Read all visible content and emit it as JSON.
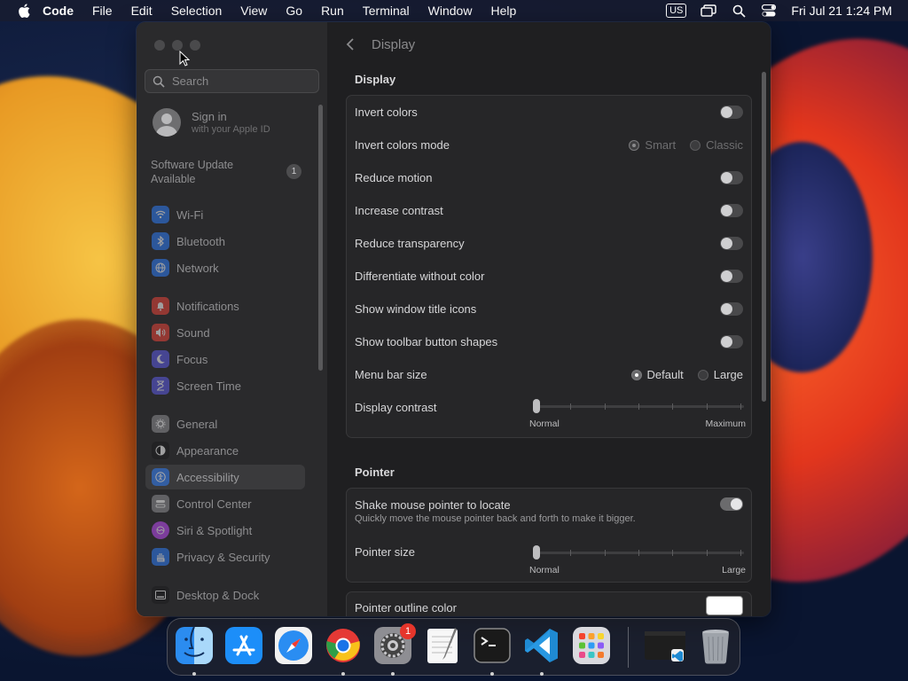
{
  "menubar": {
    "app_name": "Code",
    "items": [
      "File",
      "Edit",
      "Selection",
      "View",
      "Go",
      "Run",
      "Terminal",
      "Window",
      "Help"
    ],
    "input_source": "US",
    "clock": "Fri Jul 21  1:24 PM"
  },
  "sidebar": {
    "search_placeholder": "Search",
    "signin_title": "Sign in",
    "signin_subtitle": "with your Apple ID",
    "software_update": "Software Update Available",
    "update_count": "1",
    "items": [
      {
        "label": "Wi-Fi",
        "color": "#2f7cf6"
      },
      {
        "label": "Bluetooth",
        "color": "#2f7cf6"
      },
      {
        "label": "Network",
        "color": "#2f7cf6"
      },
      {
        "label": "Notifications",
        "color": "#e9443a"
      },
      {
        "label": "Sound",
        "color": "#e9443a"
      },
      {
        "label": "Focus",
        "color": "#5e5ce6"
      },
      {
        "label": "Screen Time",
        "color": "#5e5ce6"
      },
      {
        "label": "General",
        "color": "#8e8e93"
      },
      {
        "label": "Appearance",
        "color": "#1c1c1e"
      },
      {
        "label": "Accessibility",
        "color": "#2f7cf6"
      },
      {
        "label": "Control Center",
        "color": "#8e8e93"
      },
      {
        "label": "Siri & Spotlight",
        "color": "#c04df9"
      },
      {
        "label": "Privacy & Security",
        "color": "#2f7cf6"
      },
      {
        "label": "Desktop & Dock",
        "color": "#1c1c1e"
      }
    ],
    "selected": "Accessibility"
  },
  "main": {
    "title": "Display",
    "display_section": "Display",
    "display_rows": [
      {
        "label": "Invert colors",
        "control": "toggle",
        "on": false
      },
      {
        "label": "Invert colors mode",
        "control": "radio",
        "options": [
          "Smart",
          "Classic"
        ],
        "selected": "Smart",
        "disabled": true
      },
      {
        "label": "Reduce motion",
        "control": "toggle",
        "on": false
      },
      {
        "label": "Increase contrast",
        "control": "toggle",
        "on": false
      },
      {
        "label": "Reduce transparency",
        "control": "toggle",
        "on": false
      },
      {
        "label": "Differentiate without color",
        "control": "toggle",
        "on": false
      },
      {
        "label": "Show window title icons",
        "control": "toggle",
        "on": false
      },
      {
        "label": "Show toolbar button shapes",
        "control": "toggle",
        "on": false
      },
      {
        "label": "Menu bar size",
        "control": "radio",
        "options": [
          "Default",
          "Large"
        ],
        "selected": "Default",
        "disabled": false
      }
    ],
    "display_contrast": {
      "label": "Display contrast",
      "min_label": "Normal",
      "max_label": "Maximum",
      "value": 0
    },
    "pointer_section": "Pointer",
    "shake": {
      "label": "Shake mouse pointer to locate",
      "description": "Quickly move the mouse pointer back and forth to make it bigger.",
      "on": true
    },
    "pointer_size": {
      "label": "Pointer size",
      "min_label": "Normal",
      "max_label": "Large",
      "value": 0
    },
    "outline_color": {
      "label": "Pointer outline color",
      "color": "#ffffff"
    }
  },
  "dock": {
    "apps": [
      "Finder",
      "App Store",
      "Safari",
      "Chrome",
      "System Settings",
      "TextEdit",
      "Terminal",
      "Visual Studio Code",
      "Launchpad"
    ],
    "settings_badge": "1"
  }
}
